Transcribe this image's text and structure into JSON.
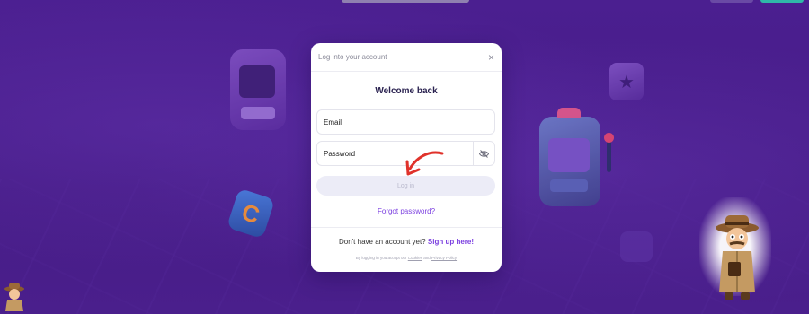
{
  "modal": {
    "title": "Log into your account",
    "close_label": "×",
    "heading": "Welcome back",
    "email_placeholder": "Email",
    "password_placeholder": "Password",
    "login_label": "Log in",
    "forgot_label": "Forgot password?",
    "signup_prompt": "Don't have an account yet?",
    "signup_label": "Sign up here!",
    "legal_prefix": "By logging in you accept our",
    "legal_cookies": "Cookies",
    "legal_and": "and",
    "legal_privacy": "Privacy Policy"
  },
  "colors": {
    "background": "#4a1f8c",
    "accent": "#7b3fe0",
    "annotation_arrow": "#e0322b"
  },
  "icons": {
    "close": "close-icon",
    "password_visibility": "eye-off-icon"
  }
}
